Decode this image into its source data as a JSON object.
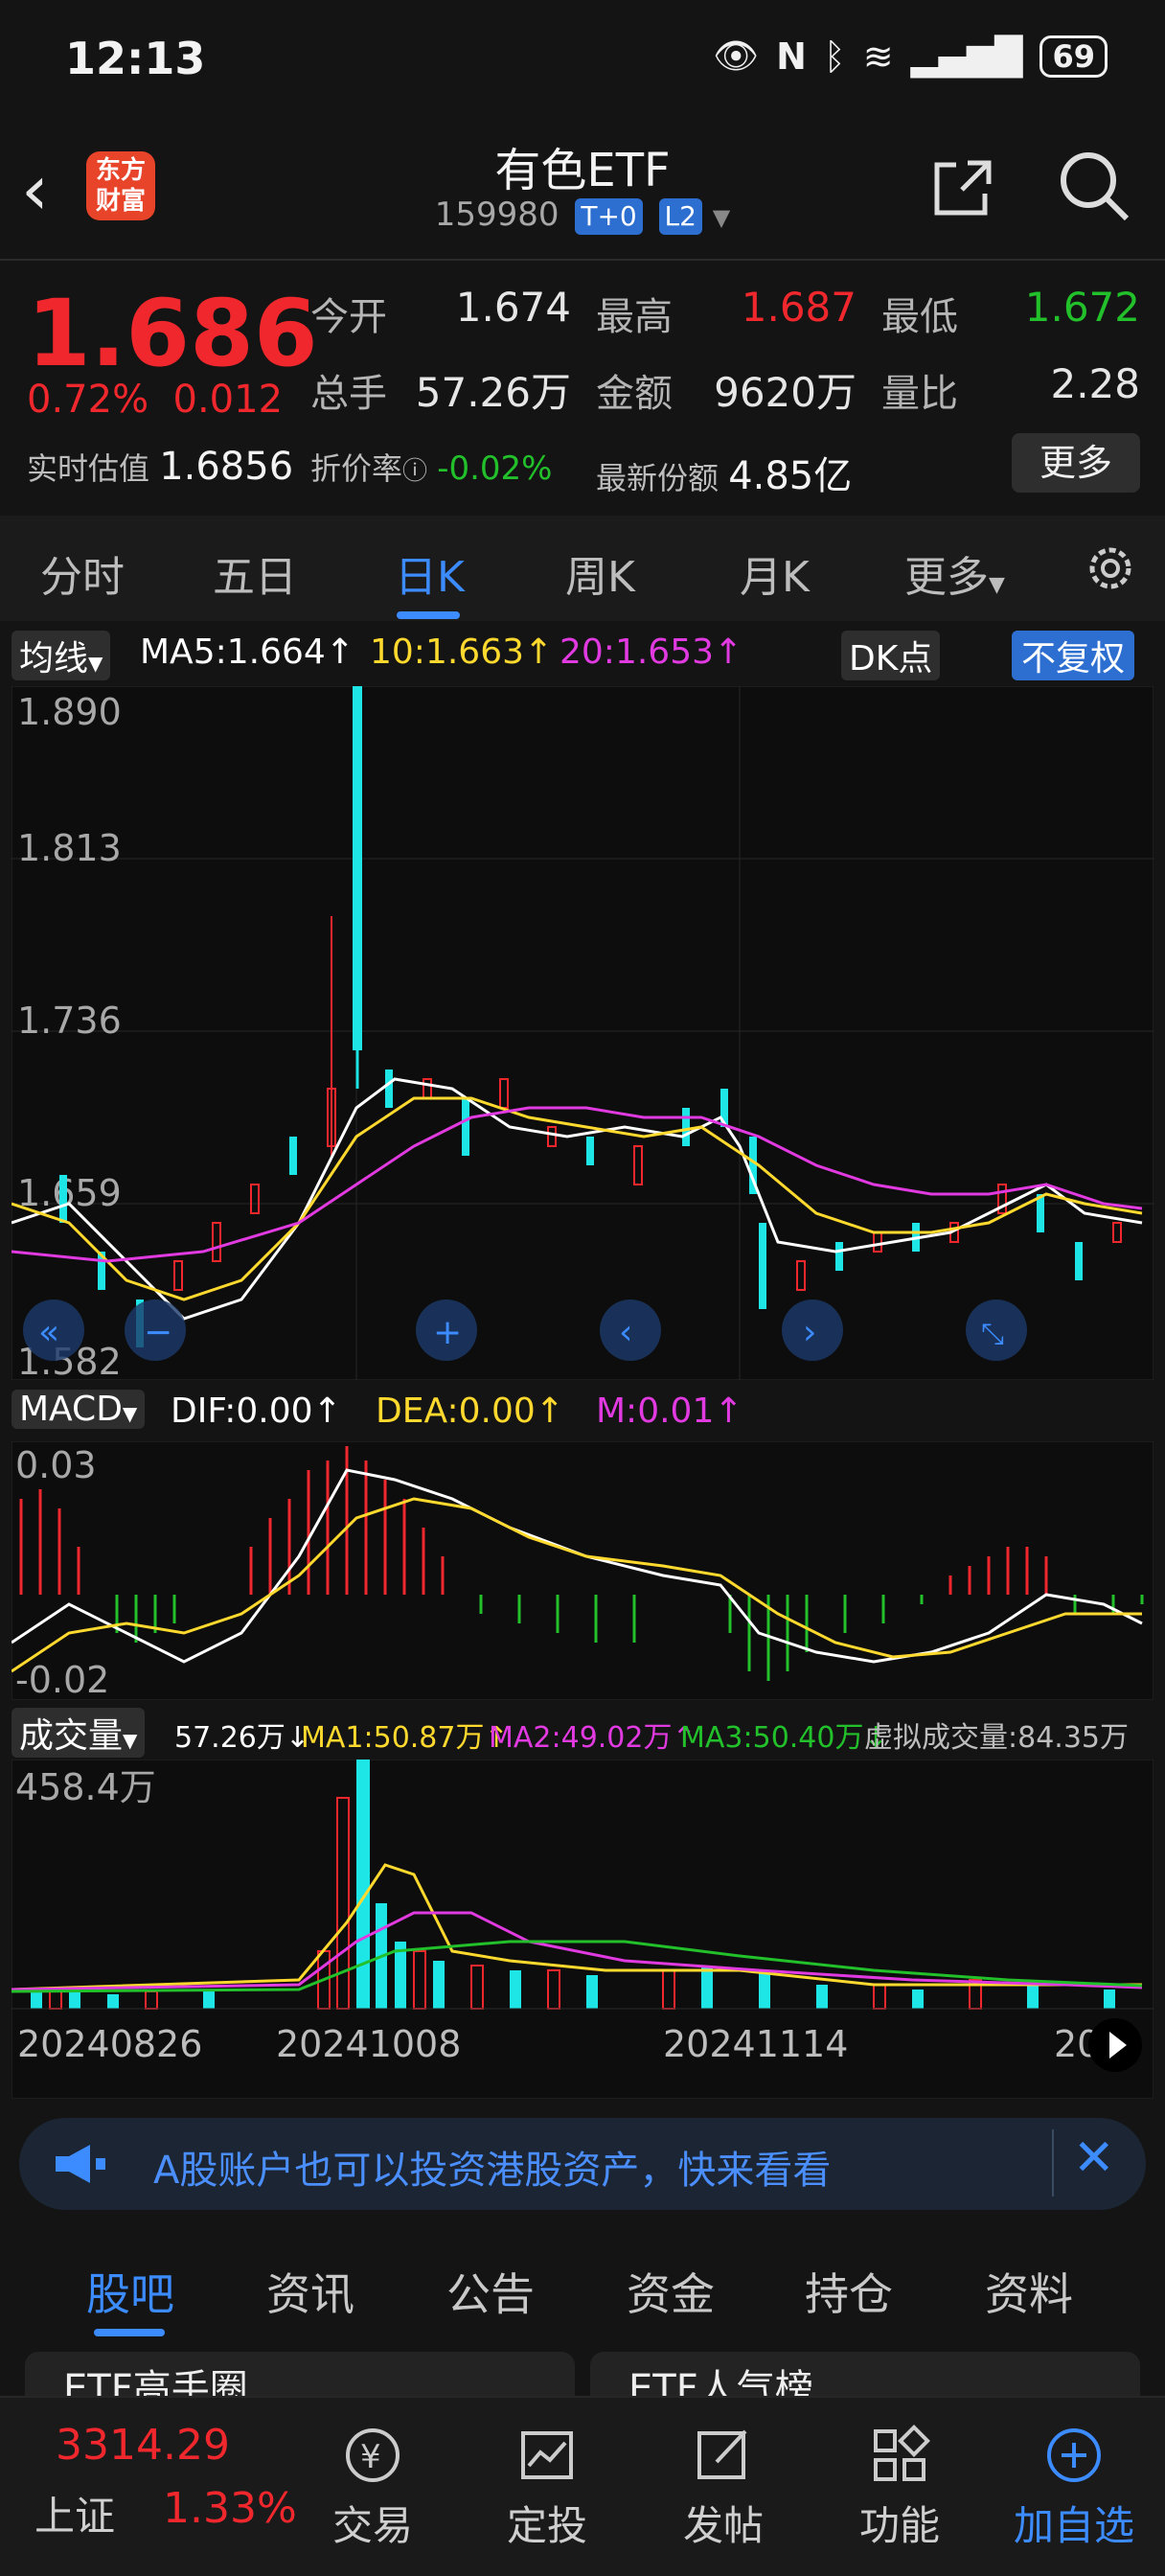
{
  "status_bar": {
    "time": "12:13",
    "battery": "69"
  },
  "header": {
    "back_icon": "back-arrow-icon",
    "logo_line1": "东方",
    "logo_line2": "财富",
    "title": "有色ETF",
    "code": "159980",
    "tag_t0": "T+0",
    "tag_l2": "L2"
  },
  "quote": {
    "price": "1.686",
    "change_pct": "0.72%",
    "change": "0.012",
    "open_label": "今开",
    "open": "1.674",
    "high_label": "最高",
    "high": "1.687",
    "low_label": "最低",
    "low": "1.672",
    "volume_label": "总手",
    "volume": "57.26万",
    "amount_label": "金额",
    "amount": "9620万",
    "ratio_label": "量比",
    "ratio": "2.28",
    "est_label": "实时估值",
    "est": "1.6856",
    "premium_label": "折价率",
    "premium": "-0.02%",
    "shares_label": "最新份额",
    "shares": "4.85亿",
    "more": "更多",
    "colors": {
      "up": "#f0282d",
      "down": "#22c02a"
    }
  },
  "period_tabs": [
    "分时",
    "五日",
    "日K",
    "周K",
    "月K",
    "更多"
  ],
  "active_period": "日K",
  "kline": {
    "ma_selector": "均线",
    "ma5": "MA5:1.664↑",
    "ma10": "10:1.663↑",
    "ma20": "20:1.653↑",
    "dk": "DK点",
    "adjust": "不复权",
    "y_ticks": [
      "1.890",
      "1.813",
      "1.736",
      "1.659",
      "1.582"
    ]
  },
  "macd": {
    "selector": "MACD",
    "dif": "DIF:0.00↑",
    "dea": "DEA:0.00↑",
    "m": "M:0.01↑",
    "y_ticks": [
      "0.03",
      "-0.02"
    ]
  },
  "vol": {
    "selector": "成交量",
    "v": "57.26万↓",
    "ma1": "MA1:50.87万↑",
    "ma2": "MA2:49.02万↑",
    "ma3": "MA3:50.40万↓",
    "virtual": "虚拟成交量:84.35万",
    "y_tick": "458.4万",
    "dates": [
      "20240826",
      "20241008",
      "20241114",
      "20"
    ]
  },
  "banner": {
    "text": "A股账户也可以投资港股资产，快来看看"
  },
  "bottom_tabs": [
    "股吧",
    "资讯",
    "公告",
    "资金",
    "持仓",
    "资料"
  ],
  "cards": {
    "left": "ETF高手圈",
    "right": "ETF人气榜"
  },
  "footer": {
    "index_value": "3314.29",
    "index_name": "上证",
    "index_change": "1.33%",
    "items": [
      {
        "label": "交易",
        "icon": "trade-icon"
      },
      {
        "label": "定投",
        "icon": "invest-icon"
      },
      {
        "label": "发帖",
        "icon": "post-icon"
      },
      {
        "label": "功能",
        "icon": "apps-icon"
      },
      {
        "label": "加自选",
        "icon": "add-favorite-icon"
      }
    ]
  }
}
